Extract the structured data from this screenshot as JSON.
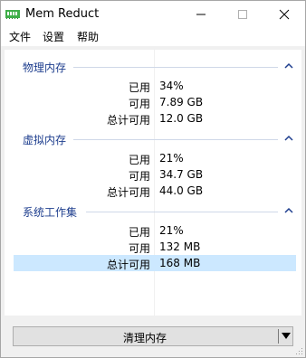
{
  "window": {
    "title": "Mem Reduct"
  },
  "menu": {
    "file": "文件",
    "settings": "设置",
    "help": "帮助"
  },
  "groups": [
    {
      "title": "物理内存",
      "rows": [
        {
          "label": "已用",
          "value": "34%"
        },
        {
          "label": "可用",
          "value": "7.89 GB"
        },
        {
          "label": "总计可用",
          "value": "12.0 GB"
        }
      ]
    },
    {
      "title": "虚拟内存",
      "rows": [
        {
          "label": "已用",
          "value": "21%"
        },
        {
          "label": "可用",
          "value": "34.7 GB"
        },
        {
          "label": "总计可用",
          "value": "44.0 GB"
        }
      ]
    },
    {
      "title": "系统工作集",
      "rows": [
        {
          "label": "已用",
          "value": "21%"
        },
        {
          "label": "可用",
          "value": "132 MB"
        },
        {
          "label": "总计可用",
          "value": "168 MB",
          "selected": true
        }
      ]
    }
  ],
  "actions": {
    "clean_label": "清理内存"
  },
  "colors": {
    "group_title": "#1e3e8e",
    "selection": "#cce8ff",
    "icon_green": "#3fae49"
  },
  "icons": {
    "app": "memory-chip-icon",
    "minimize": "minimize-icon",
    "maximize": "maximize-icon",
    "close": "close-icon",
    "collapse": "chevron-up-icon",
    "dropdown": "triangle-down-icon"
  }
}
